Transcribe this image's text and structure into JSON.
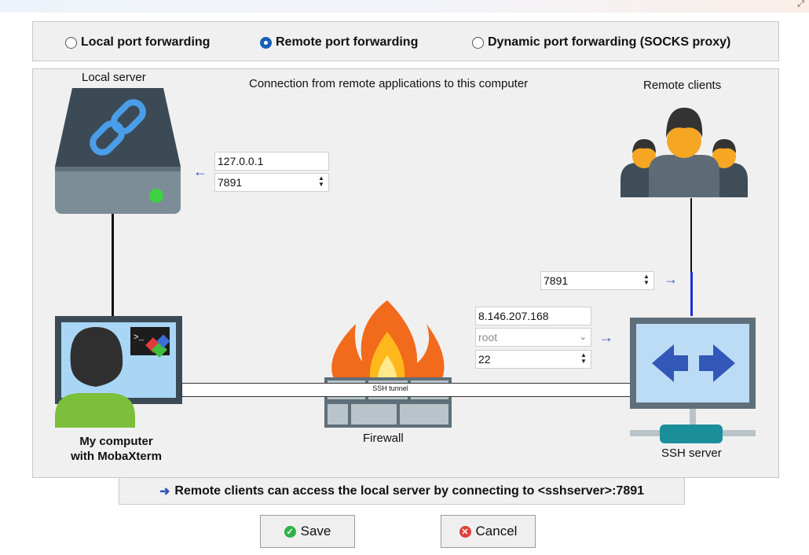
{
  "window": {
    "corner_glyph": "⤢"
  },
  "modes": {
    "options": [
      {
        "label": "Local port forwarding",
        "selected": false
      },
      {
        "label": "Remote port forwarding",
        "selected": true
      },
      {
        "label": "Dynamic port forwarding (SOCKS proxy)",
        "selected": false
      }
    ]
  },
  "diagram": {
    "heading": "Connection from remote applications to this computer",
    "local_server_label": "Local server",
    "remote_clients_label": "Remote clients",
    "my_computer_label_line1": "My computer",
    "my_computer_label_line2": "with MobaXterm",
    "firewall_label": "Firewall",
    "ssh_server_label": "SSH server",
    "tunnel_label": "SSH tunnel"
  },
  "fields": {
    "local_host": "127.0.0.1",
    "local_port": "7891",
    "remote_port": "7891",
    "ssh_server_host": "8.146.207.168",
    "ssh_user": "root",
    "ssh_port": "22"
  },
  "status": {
    "arrow": "➜",
    "text": "Remote clients can access the local server by connecting to <sshserver>:7891"
  },
  "buttons": {
    "save": "Save",
    "cancel": "Cancel"
  },
  "colors": {
    "accent": "#1a5fb4",
    "arrow_blue": "#3357b8",
    "ok_green": "#2fb24a",
    "cancel_red": "#e0403a"
  }
}
